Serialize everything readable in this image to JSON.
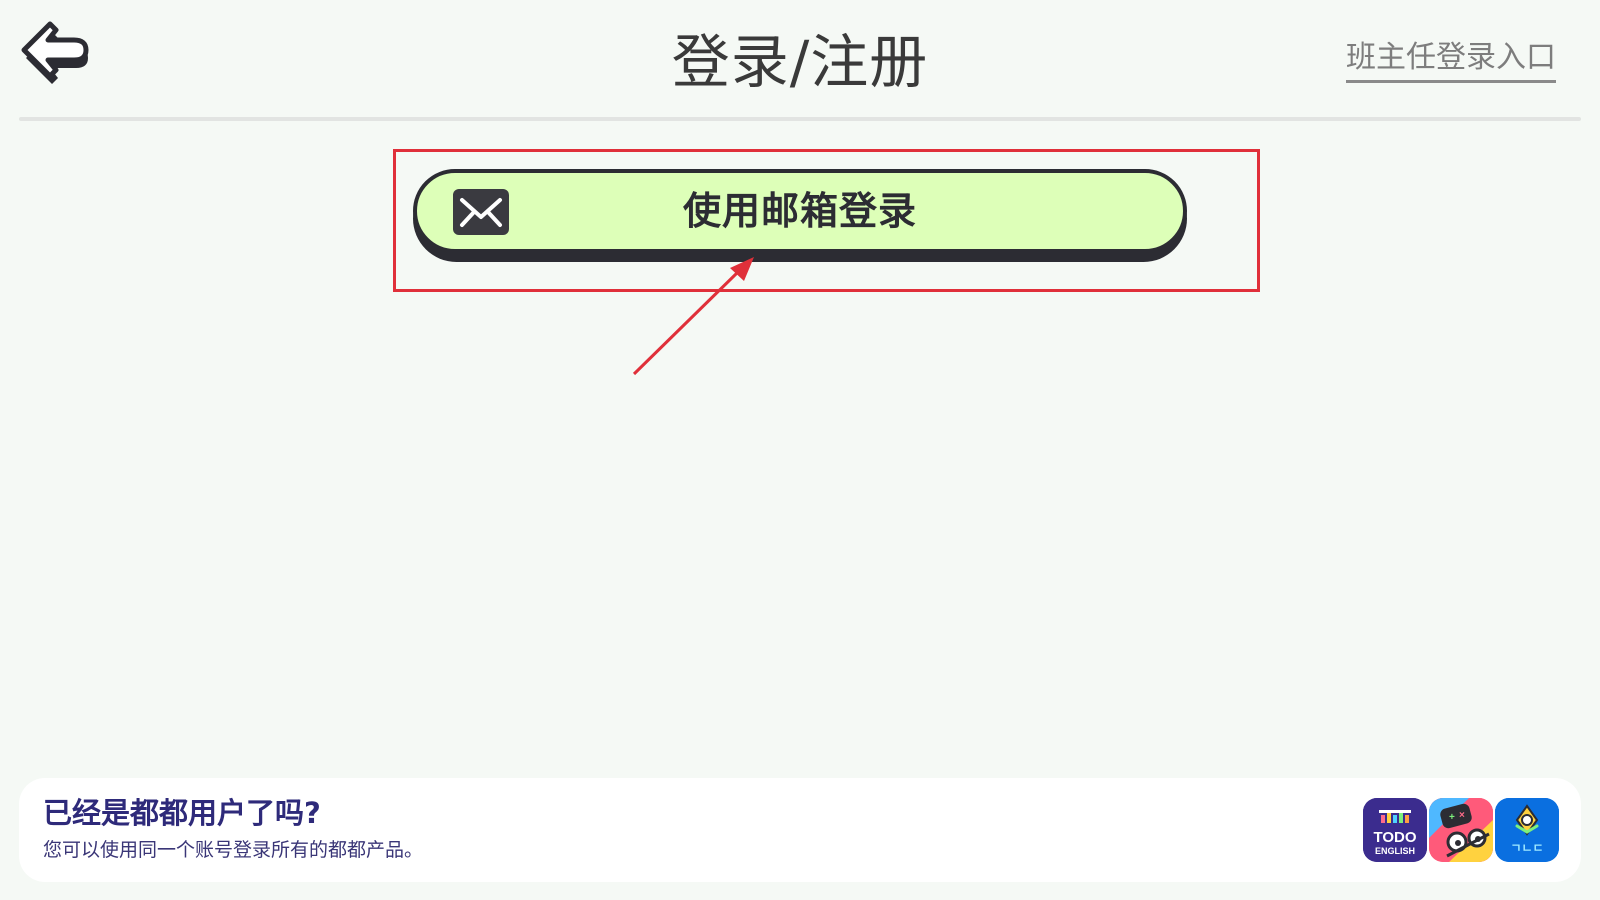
{
  "header": {
    "title": "登录/注册",
    "teacher_login_link": "班主任登录入口",
    "back_icon": "back-arrow-icon"
  },
  "login": {
    "email_button_label": "使用邮箱登录",
    "email_icon": "mail-icon"
  },
  "annotation": {
    "highlight_color": "#e0303a"
  },
  "footer": {
    "title": "已经是都都用户了吗?",
    "subtitle": "您可以使用同一个账号登录所有的都都产品。",
    "apps": [
      {
        "icon": "todo-english-app-icon",
        "line1": "TODO",
        "line2": "ENGLISH"
      },
      {
        "icon": "todo-math-app-icon"
      },
      {
        "icon": "todo-korean-app-icon",
        "label": "ㄱㄴㄷ"
      }
    ]
  },
  "colors": {
    "background": "#f5f9f5",
    "button_fill": "#ddffb8",
    "button_border": "#2c2c33",
    "footer_text": "#2e2a7a"
  }
}
